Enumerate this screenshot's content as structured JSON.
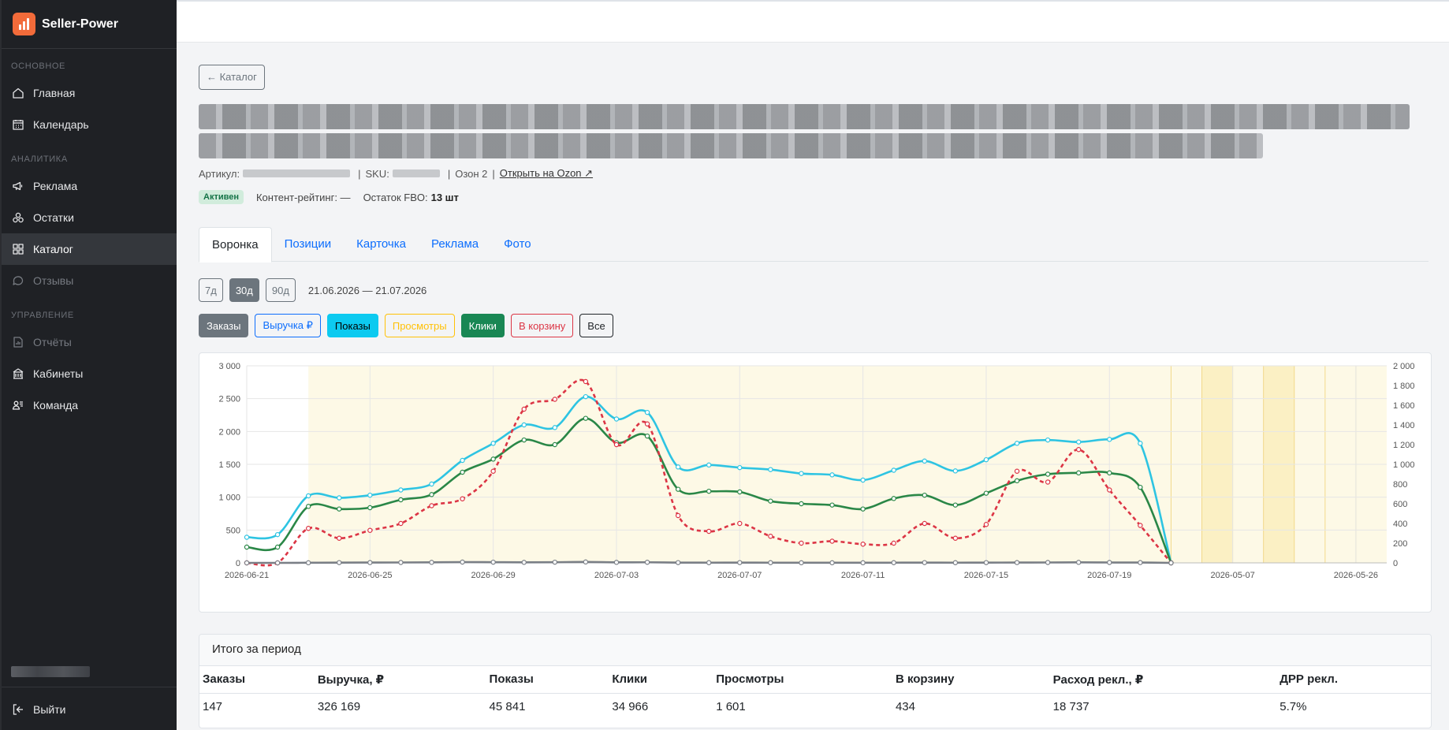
{
  "app": {
    "name": "Seller-Power"
  },
  "sidebar": {
    "sections": [
      {
        "title": "ОСНОВНОЕ",
        "items": [
          {
            "label": "Главная",
            "icon": "home-icon",
            "state": "normal"
          },
          {
            "label": "Календарь",
            "icon": "calendar-icon",
            "state": "normal"
          }
        ]
      },
      {
        "title": "АНАЛИТИКА",
        "items": [
          {
            "label": "Реклама",
            "icon": "megaphone-icon",
            "state": "normal"
          },
          {
            "label": "Остатки",
            "icon": "boxes-icon",
            "state": "normal"
          },
          {
            "label": "Каталог",
            "icon": "grid-icon",
            "state": "active"
          },
          {
            "label": "Отзывы",
            "icon": "chat-icon",
            "state": "disabled"
          }
        ]
      },
      {
        "title": "УПРАВЛЕНИЕ",
        "items": [
          {
            "label": "Отчёты",
            "icon": "report-icon",
            "state": "disabled"
          },
          {
            "label": "Кабинеты",
            "icon": "building-icon",
            "state": "normal"
          },
          {
            "label": "Команда",
            "icon": "team-icon",
            "state": "normal"
          }
        ]
      }
    ],
    "logout_label": "Выйти"
  },
  "product": {
    "back_label": "← Каталог",
    "article_label": "Артикул:",
    "sku_label": "SKU:",
    "ozon_label": "Озон 2",
    "ozon_link": "Открыть на Ozon ↗",
    "status": "Активен",
    "content_rating_label": "Контент-рейтинг: —",
    "stock_label": "Остаток FBO:",
    "stock_value": "13 шт"
  },
  "tabs": [
    "Воронка",
    "Позиции",
    "Карточка",
    "Реклама",
    "Фото"
  ],
  "period": {
    "buttons": [
      "7д",
      "30д",
      "90д"
    ],
    "selected": "30д",
    "range": "21.06.2026 — 21.07.2026"
  },
  "metric_toggles": [
    {
      "label": "Заказы",
      "style": "filled",
      "color": "#6c757d"
    },
    {
      "label": "Выручка ₽",
      "style": "outline",
      "color": "#0d6efd"
    },
    {
      "label": "Показы",
      "style": "filled",
      "color": "#0dcaf0"
    },
    {
      "label": "Просмотры",
      "style": "outline",
      "color": "#ffc107"
    },
    {
      "label": "Клики",
      "style": "filled",
      "color": "#198754"
    },
    {
      "label": "В корзину",
      "style": "outline",
      "color": "#dc3545"
    },
    {
      "label": "Все",
      "style": "outline",
      "color": "#212529"
    }
  ],
  "chart_data": {
    "type": "line",
    "x": [
      "2026-06-21",
      "2026-06-22",
      "2026-06-23",
      "2026-06-24",
      "2026-06-25",
      "2026-06-26",
      "2026-06-27",
      "2026-06-28",
      "2026-06-29",
      "2026-06-30",
      "2026-07-01",
      "2026-07-02",
      "2026-07-03",
      "2026-07-04",
      "2026-07-05",
      "2026-07-06",
      "2026-07-07",
      "2026-07-08",
      "2026-07-09",
      "2026-07-10",
      "2026-07-11",
      "2026-07-12",
      "2026-07-13",
      "2026-07-14",
      "2026-07-15",
      "2026-07-16",
      "2026-07-17",
      "2026-07-18",
      "2026-07-19",
      "2026-07-20",
      "2026-07-21"
    ],
    "x_tick_labels": [
      "2026-06-21",
      "2026-06-25",
      "2026-06-29",
      "2026-07-03",
      "2026-07-07",
      "2026-07-11",
      "2026-07-15",
      "2026-07-19",
      "2026-05-07",
      "2026-05-26"
    ],
    "y_left": {
      "ticks": [
        "0",
        "500",
        "1 000",
        "1 500",
        "2 000",
        "2 500",
        "3 000"
      ],
      "min": 0,
      "max": 3000
    },
    "y_right": {
      "ticks": [
        "0",
        "200",
        "400",
        "600",
        "800",
        "1 000",
        "1 200",
        "1 400",
        "1 600",
        "1 800",
        "2 000"
      ],
      "min": 0,
      "max": 2000
    },
    "grid": true,
    "series": [
      {
        "axis": "left",
        "color": "#2ec4e2",
        "style": "solid",
        "values": [
          390,
          430,
          1020,
          990,
          1030,
          1110,
          1200,
          1560,
          1820,
          2100,
          2060,
          2530,
          2190,
          2290,
          1460,
          1490,
          1450,
          1420,
          1360,
          1340,
          1260,
          1410,
          1550,
          1400,
          1570,
          1820,
          1870,
          1840,
          1880,
          1820,
          0
        ]
      },
      {
        "axis": "left",
        "color": "#2a8747",
        "style": "solid",
        "values": [
          240,
          240,
          860,
          820,
          840,
          960,
          1040,
          1380,
          1580,
          1870,
          1800,
          2200,
          1830,
          1930,
          1120,
          1090,
          1080,
          940,
          900,
          880,
          820,
          980,
          1030,
          880,
          1060,
          1250,
          1350,
          1370,
          1370,
          1150,
          0
        ]
      },
      {
        "axis": "right",
        "color": "#dc3545",
        "style": "dashed",
        "values": [
          0,
          0,
          350,
          250,
          330,
          400,
          580,
          650,
          930,
          1560,
          1660,
          1840,
          1200,
          1410,
          480,
          320,
          400,
          270,
          200,
          220,
          190,
          200,
          400,
          250,
          390,
          930,
          820,
          1150,
          740,
          380,
          0
        ]
      },
      {
        "axis": "left",
        "color": "#7a7f86",
        "style": "solid",
        "values": [
          0,
          0,
          2,
          4,
          5,
          6,
          8,
          12,
          10,
          8,
          10,
          14,
          8,
          9,
          4,
          3,
          4,
          3,
          2,
          2,
          2,
          3,
          4,
          3,
          4,
          5,
          6,
          8,
          6,
          5,
          0
        ]
      }
    ]
  },
  "totals": {
    "title": "Итого за период",
    "headers": [
      "Заказы",
      "Выручка, ₽",
      "Показы",
      "Клики",
      "Просмотры",
      "В корзину",
      "Расход рекл., ₽",
      "ДРР рекл."
    ],
    "values": [
      "147",
      "326 169",
      "45 841",
      "34 966",
      "1 601",
      "434",
      "18 737",
      "5.7%"
    ]
  }
}
